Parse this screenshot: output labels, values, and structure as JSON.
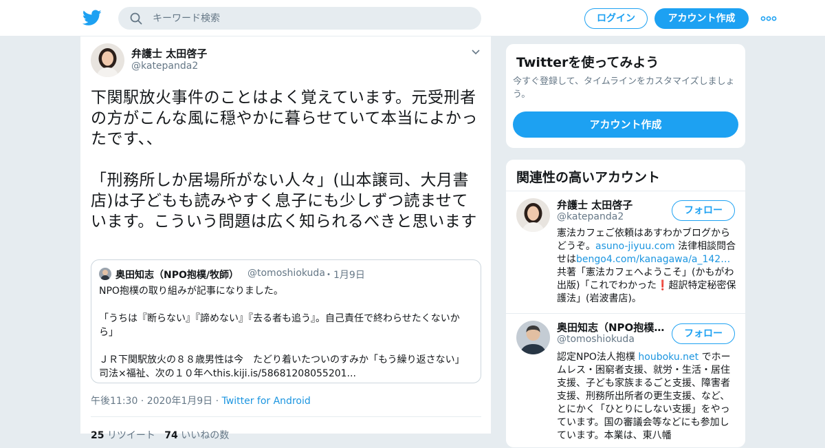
{
  "header": {
    "search_placeholder": "キーワード検索",
    "login_label": "ログイン",
    "signup_label": "アカウント作成",
    "icons": [
      "twitter-logo-icon",
      "search-icon",
      "more-dots-icon"
    ]
  },
  "tweet": {
    "author_name": "弁護士 太田啓子",
    "author_handle": "@katepanda2",
    "text": "下関駅放火事件のことはよく覚えています。元受刑者の方がこんな風に穏やかに暮らせていて本当によかったです、、\n\n「刑務所しか居場所がない人々」(山本譲司、大月書店)は子どもも読みやすく息子にも少しずつ読ませています。こういう問題は広く知られるべきと思います",
    "quote": {
      "author_name": "奥田知志（NPO抱樸/牧師）",
      "author_handle": "@tomoshiokuda",
      "date": "・1月9日",
      "text": "NPO抱樸の取り組みが記事になりました。\n\n「うちは『断らない』『諦めない』『去る者も追う』。自己責任で終わらせたくないから」\n\nＪＲ下関駅放火の８８歳男性は今　たどり着いたついのすみか「もう繰り返さない」　司法×福祉、次の１０年へthis.kiji.is/58681208055201..."
    },
    "time": "午後11:30",
    "date": "2020年1月9日",
    "source": "Twitter for Android",
    "retweets_count": "25",
    "retweets_label": "リツイート",
    "likes_count": "74",
    "likes_label": "いいねの数"
  },
  "signup_card": {
    "title": "Twitterを使ってみよう",
    "description": "今すぐ登録して、タイムラインをカスタマイズしましょう。",
    "button_label": "アカウント作成"
  },
  "related": {
    "title": "関連性の高いアカウント",
    "accounts": [
      {
        "name": "弁護士 太田啓子",
        "handle": "@katepanda2",
        "follow_label": "フォロー",
        "bio": {
          "t1": "憲法カフェご依頼はあすわかブログからどうぞ。",
          "link1": "asuno-jiyuu.com",
          "t2": " 法律相談問合せは",
          "link2": "bengo4.com/kanagawa/a_142…",
          "t3": " 共著「憲法カフェへようこそ」(かもがわ出版)「これでわかった",
          "mark": "❗",
          "t4": "超訳特定秘密保護法」(岩波書店)。"
        }
      },
      {
        "name": "奥田知志（NPO抱樸/牧師）",
        "handle": "@tomoshiokuda",
        "follow_label": "フォロー",
        "bio": {
          "t1": "認定NPO法人抱樸 ",
          "link1": "houboku.net",
          "t2": " でホームレス・困窮者支援、就労・生活・居住支援、子ども家族まるごと支援、障害者支援、刑務所出所者の更生支援、など、とにかく「ひとりにしない支援」をやっています。国の審議会等などにも参加しています。本業は、東八幡"
        }
      }
    ]
  }
}
